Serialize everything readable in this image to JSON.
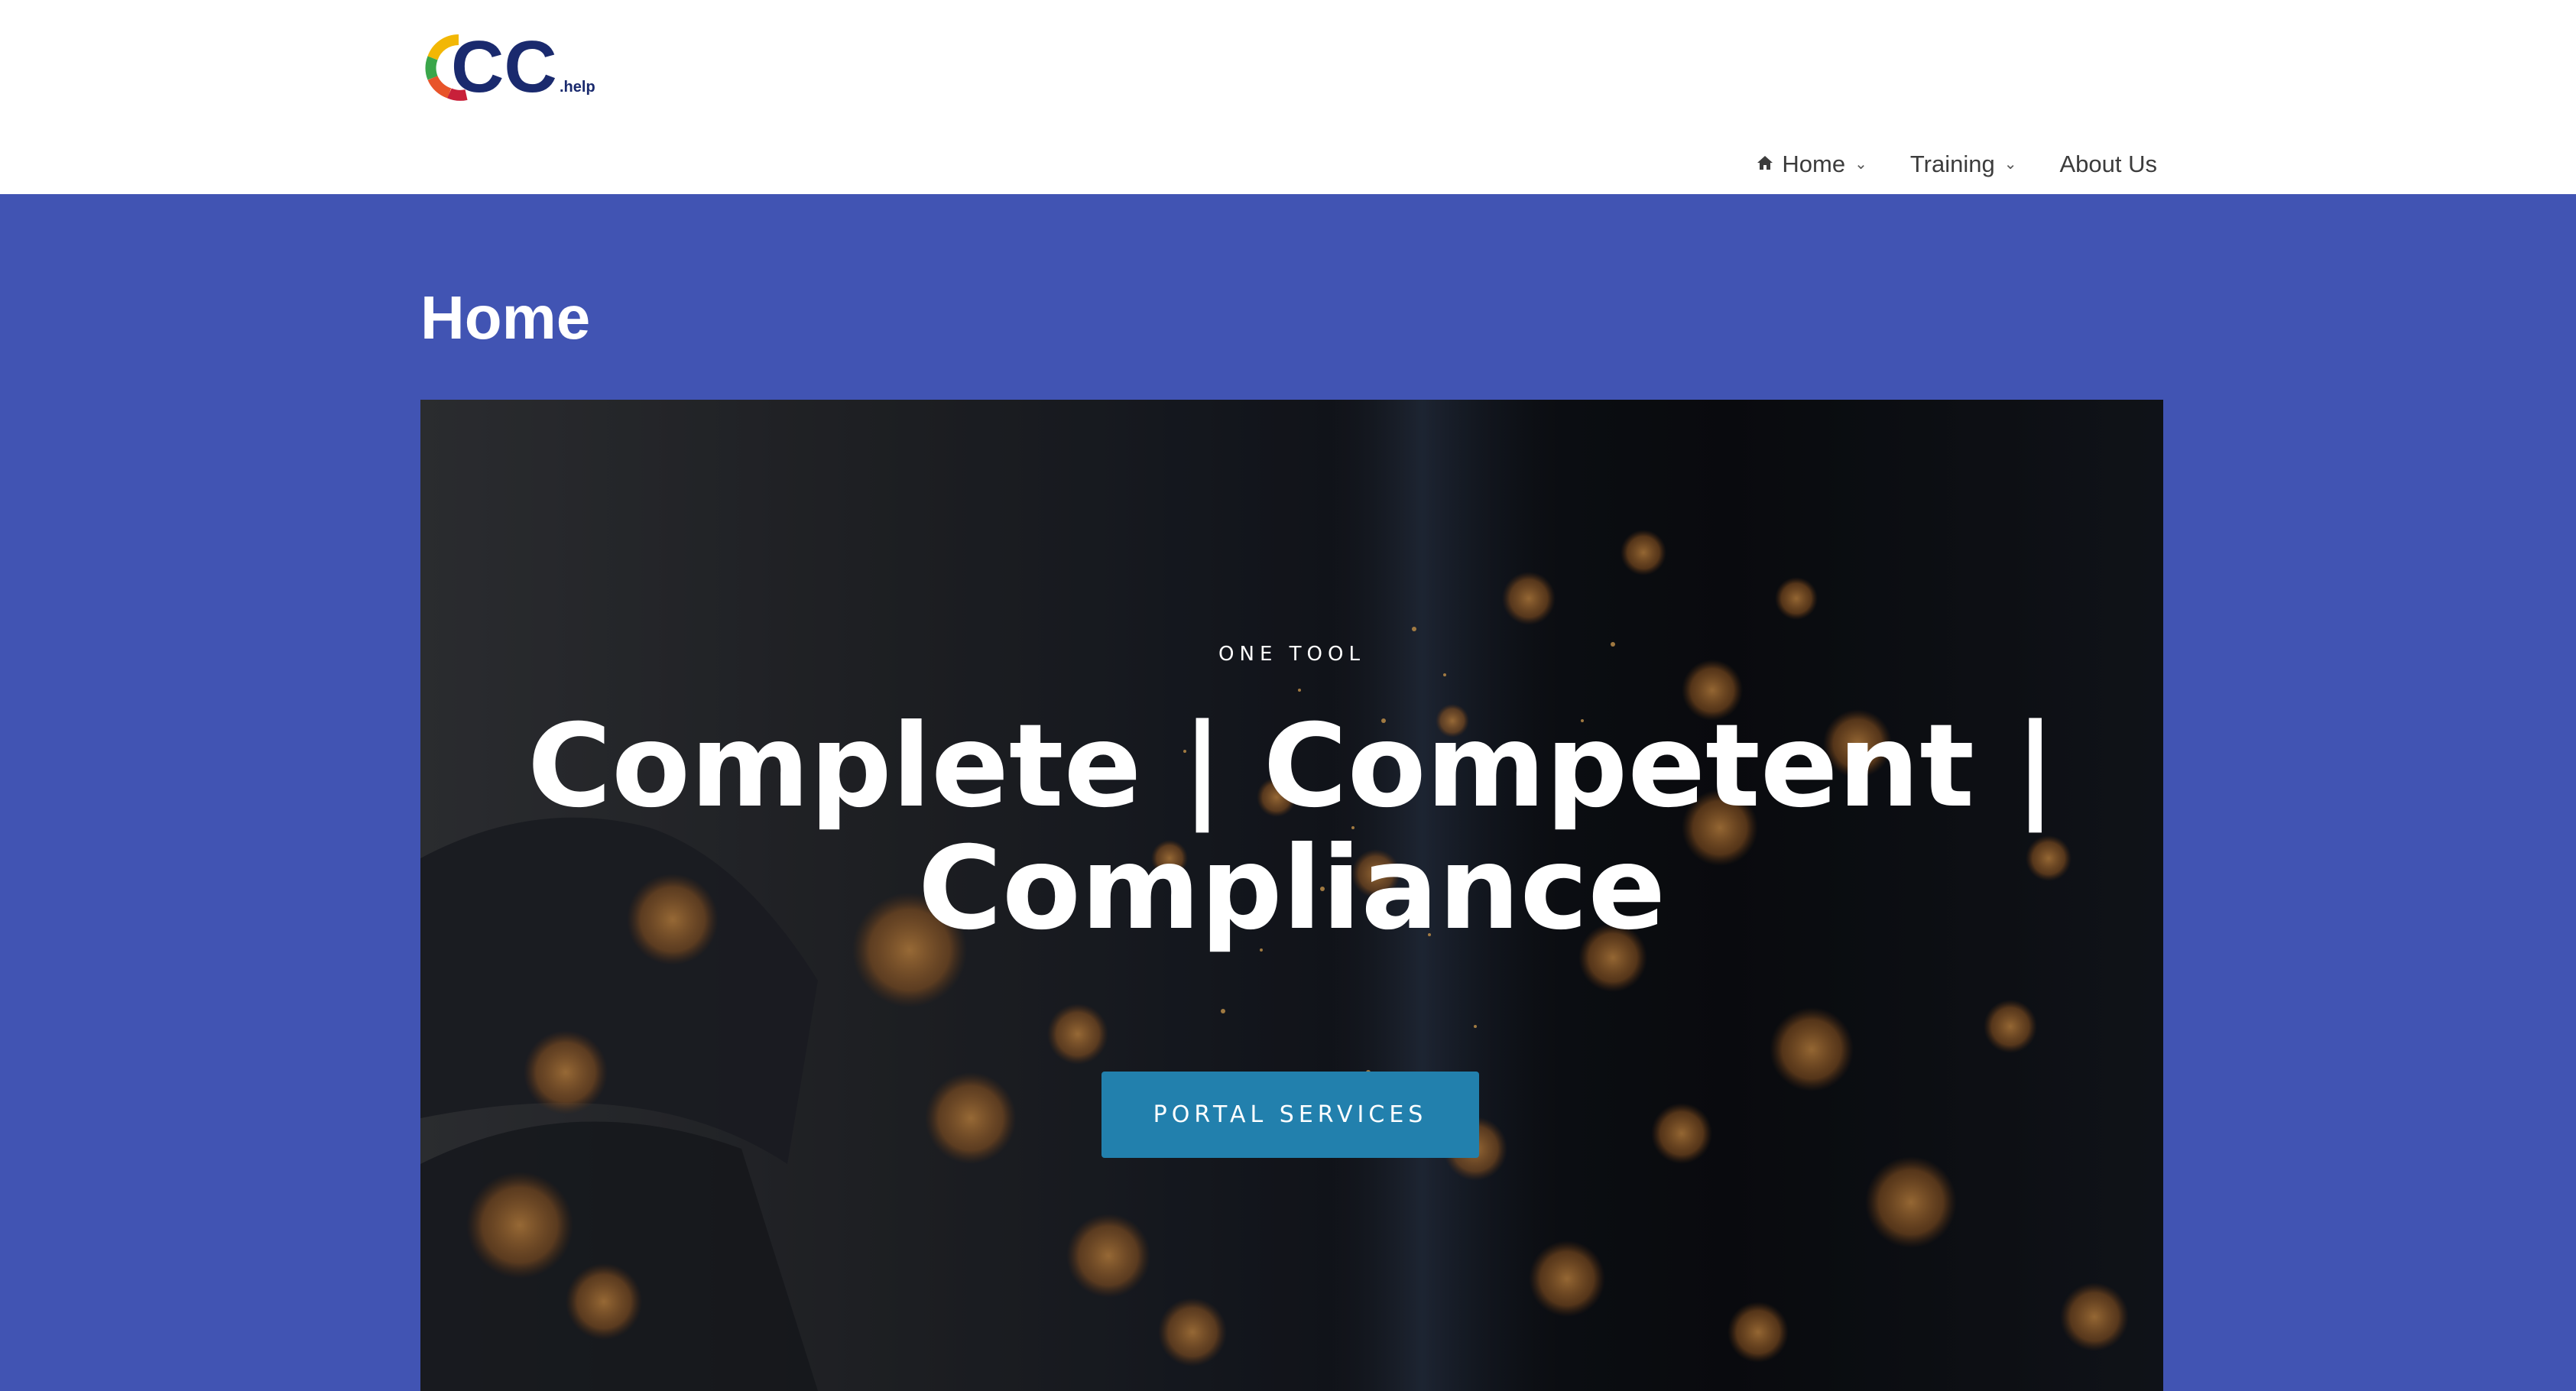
{
  "header": {
    "logo_text": "CC",
    "logo_suffix": ".help",
    "nav": [
      {
        "label": "Home",
        "icon": "home-icon",
        "has_dropdown": true
      },
      {
        "label": "Training",
        "has_dropdown": true
      },
      {
        "label": "About Us",
        "has_dropdown": false
      }
    ]
  },
  "page": {
    "title": "Home"
  },
  "hero": {
    "eyebrow": "ONE TOOL",
    "headline": "Complete | Competent | Compliance",
    "cta_label": "PORTAL SERVICES"
  },
  "colors": {
    "page_background": "#4154b3",
    "header_background": "#ffffff",
    "cta_background": "#2280ad",
    "logo_text": "#1a2a6e"
  }
}
